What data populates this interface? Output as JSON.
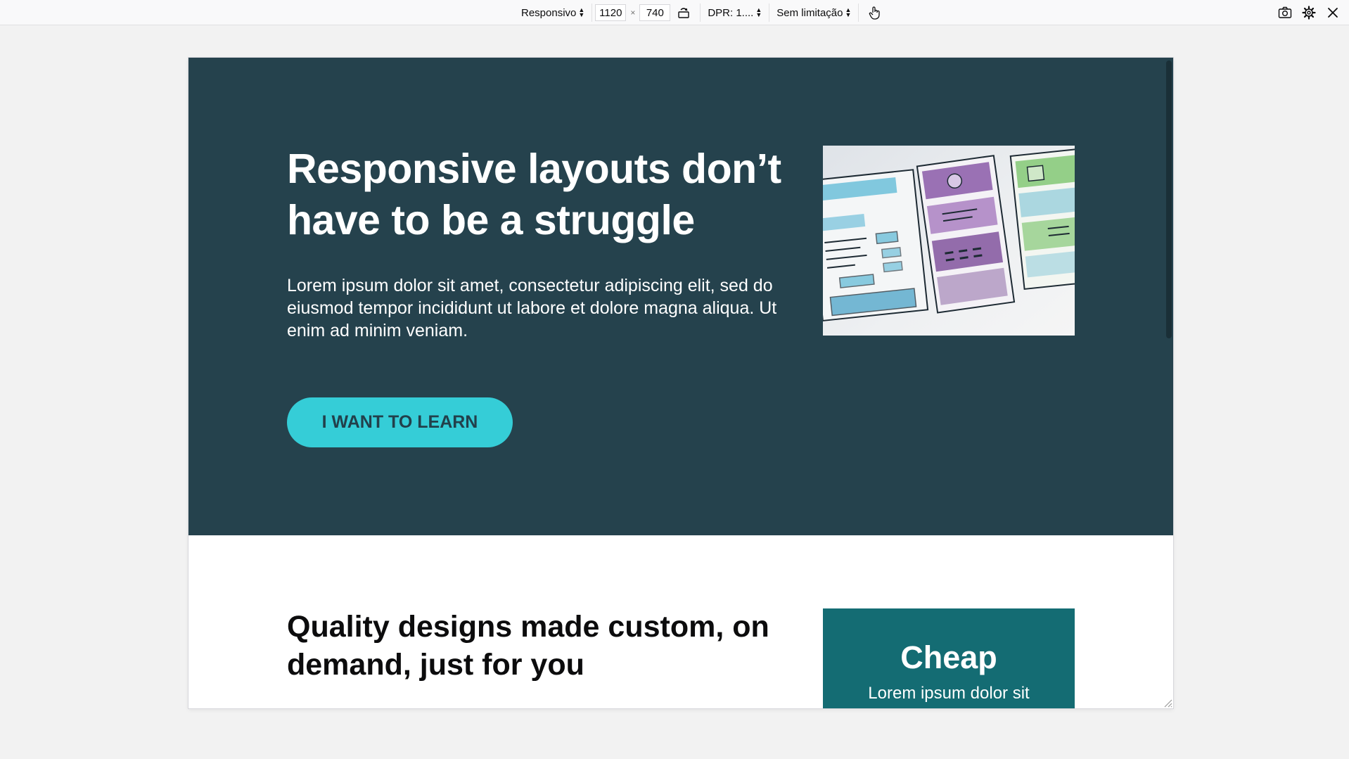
{
  "toolbar": {
    "device_select": "Responsivo",
    "width_value": "1120",
    "height_value": "740",
    "times_sign": "×",
    "dpr_select": "DPR: 1....",
    "throttle_select": "Sem limitação",
    "icons": {
      "rotate": "rotate-viewport-icon",
      "touch": "touch-simulation-icon",
      "screenshot": "screenshot-icon",
      "settings": "gear-icon",
      "close": "close-icon"
    }
  },
  "hero": {
    "title": "Responsive layouts don’t have to be a struggle",
    "text": "Lorem ipsum dolor sit amet, consectetur adipiscing elit, sed do eiusmod tempor incididunt ut labore et dolore magna aliqua. Ut enim ad minim veniam.",
    "button_label": "I WANT TO LEARN",
    "image": "wireframe-sketch-image"
  },
  "section2": {
    "title": "Quality designs made custom, on demand, just for you",
    "card_title": "Cheap",
    "card_text": "Lorem ipsum dolor sit"
  },
  "colors": {
    "hero_bg": "#25424d",
    "button_bg": "#35cdd7",
    "button_text": "#22404b",
    "card_bg": "#146c73",
    "page_bg": "#f2f2f2"
  }
}
